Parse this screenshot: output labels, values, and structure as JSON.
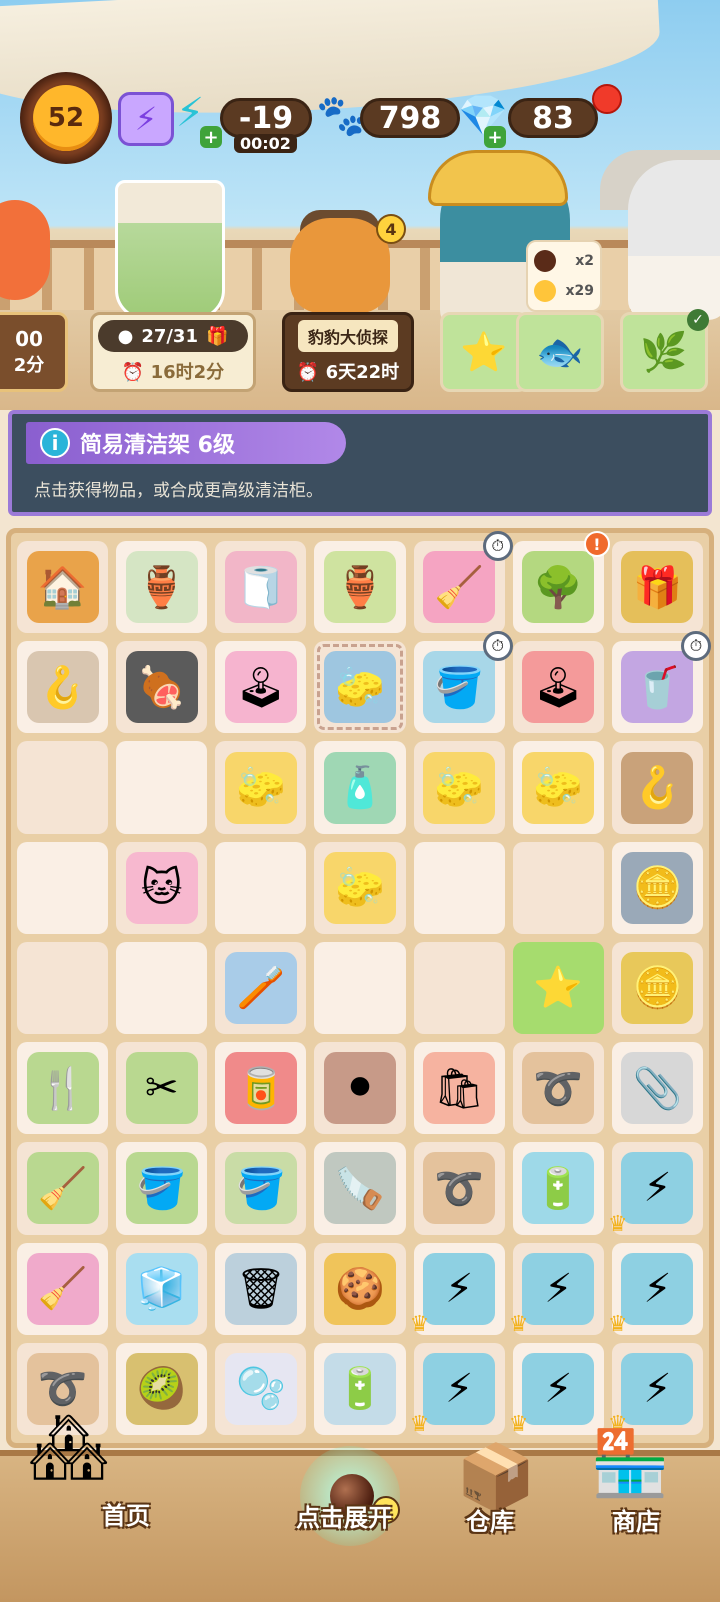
{
  "hud": {
    "level": "52",
    "energy_value": "-19",
    "energy_timer": "00:02",
    "paw_coins": "798",
    "gems": "83"
  },
  "scene": {
    "cat_badge": "4",
    "customer_needs": [
      {
        "qty": "x2"
      },
      {
        "qty": "x29"
      }
    ]
  },
  "tasks": {
    "left_partial_top": "00",
    "left_partial_bottom": "2分",
    "order_progress": "27/31",
    "order_time": "16时2分",
    "event_title": "豹豹大侦探",
    "event_time": "6天22时"
  },
  "info": {
    "title": "简易清洁架 6级",
    "description": "点击获得物品，或合成更高级清洁柜。"
  },
  "grid": {
    "rows": [
      [
        {
          "icon": "cat-house-icon",
          "glyph": "🏠",
          "bg": "#e9a34a"
        },
        {
          "icon": "orange-vase-icon",
          "glyph": "🏺",
          "bg": "#d5e5c4"
        },
        {
          "icon": "towel-rack-icon",
          "glyph": "🧻",
          "bg": "#f2b6c8"
        },
        {
          "icon": "green-vase-icon",
          "glyph": "🏺",
          "bg": "#cfe3a0"
        },
        {
          "icon": "cleaning-shelf-icon",
          "glyph": "🧹",
          "bg": "#f5a4c2",
          "badge": "timer"
        },
        {
          "icon": "bonsai-icon",
          "glyph": "🌳",
          "bg": "#b4d880",
          "badge": "alert",
          "badge_text": "!"
        },
        {
          "icon": "gift-box-icon",
          "glyph": "🎁",
          "bg": "#e5bf5a"
        }
      ],
      [
        {
          "icon": "hook-tool-icon",
          "glyph": "🪝",
          "bg": "#d9c6b0"
        },
        {
          "icon": "bbq-grill-icon",
          "glyph": "🍖",
          "bg": "#5b5b5b"
        },
        {
          "icon": "claw-machine-icon",
          "glyph": "🕹",
          "bg": "#f6b4cf"
        },
        {
          "icon": "cleaning-shelf-icon",
          "glyph": "🧽",
          "bg": "#9ec6e0",
          "focus": true
        },
        {
          "icon": "mop-bucket-icon",
          "glyph": "🪣",
          "bg": "#a8d7e8",
          "badge": "timer"
        },
        {
          "icon": "claw-machine-red-icon",
          "glyph": "🕹",
          "bg": "#f49a9a"
        },
        {
          "icon": "vending-machine-icon",
          "glyph": "🥤",
          "bg": "#c3a6e2",
          "badge": "timer"
        }
      ],
      [
        {
          "icon": "",
          "glyph": "",
          "bg": ""
        },
        {
          "icon": "",
          "glyph": "",
          "bg": ""
        },
        {
          "icon": "sponge-icon",
          "glyph": "🧽",
          "bg": "#f8d66a"
        },
        {
          "icon": "spray-bottle-icon",
          "glyph": "🧴",
          "bg": "#9fd7b4"
        },
        {
          "icon": "sponge-icon",
          "glyph": "🧽",
          "bg": "#f8d66a"
        },
        {
          "icon": "sponge-icon",
          "glyph": "🧽",
          "bg": "#f8d66a"
        },
        {
          "icon": "hook-tool-icon",
          "glyph": "🪝",
          "bg": "#c9a27a"
        }
      ],
      [
        {
          "icon": "",
          "glyph": "",
          "bg": ""
        },
        {
          "icon": "cat-towel-icon",
          "glyph": "🐱",
          "bg": "#f7b8cf"
        },
        {
          "icon": "",
          "glyph": "",
          "bg": ""
        },
        {
          "icon": "sponge-icon",
          "glyph": "🧽",
          "bg": "#f8d66a"
        },
        {
          "icon": "",
          "glyph": "",
          "bg": ""
        },
        {
          "icon": "",
          "glyph": "",
          "bg": ""
        },
        {
          "icon": "coin-tin-icon",
          "glyph": "🪙",
          "bg": "#9aa9b8"
        }
      ],
      [
        {
          "icon": "",
          "glyph": "",
          "bg": ""
        },
        {
          "icon": "",
          "glyph": "",
          "bg": ""
        },
        {
          "icon": "toothpaste-icon",
          "glyph": "🪥",
          "bg": "#a9cce8"
        },
        {
          "icon": "",
          "glyph": "",
          "bg": ""
        },
        {
          "icon": "",
          "glyph": "",
          "bg": ""
        },
        {
          "icon": "starfish-icon",
          "glyph": "⭐",
          "bg": "#a6dc6e",
          "selected": true
        },
        {
          "icon": "gold-bars-icon",
          "glyph": "🪙",
          "bg": "#e8c85a"
        }
      ],
      [
        {
          "icon": "garden-fork-icon",
          "glyph": "🍴",
          "bg": "#b9d890"
        },
        {
          "icon": "pruning-shears-icon",
          "glyph": "✂",
          "bg": "#b9d890"
        },
        {
          "icon": "soda-can-icon",
          "glyph": "🥫",
          "bg": "#f08a8a"
        },
        {
          "icon": "tapioca-balls-icon",
          "glyph": "⚫",
          "bg": "#c79a88"
        },
        {
          "icon": "plastic-bag-icon",
          "glyph": "🛍",
          "bg": "#f6b3a0"
        },
        {
          "icon": "rubber-band-icon",
          "glyph": "➰",
          "bg": "#e4c29c"
        },
        {
          "icon": "paper-clip-icon",
          "glyph": "📎",
          "bg": "#d7d7d7"
        }
      ],
      [
        {
          "icon": "rake-icon",
          "glyph": "🧹",
          "bg": "#b9d890"
        },
        {
          "icon": "paint-can-icon",
          "glyph": "🪣",
          "bg": "#b9d890"
        },
        {
          "icon": "paint-cans-icon",
          "glyph": "🪣",
          "bg": "#c9dca6"
        },
        {
          "icon": "chainsaw-icon",
          "glyph": "🪚",
          "bg": "#c0c8c0"
        },
        {
          "icon": "rubber-band-icon",
          "glyph": "➰",
          "bg": "#e4c29c"
        },
        {
          "icon": "battery-icon",
          "glyph": "🔋",
          "bg": "#9ed9e8"
        },
        {
          "icon": "battery-pack-icon",
          "glyph": "⚡",
          "bg": "#8ed0e2",
          "crown": true
        }
      ],
      [
        {
          "icon": "scraper-icon",
          "glyph": "🧹",
          "bg": "#f0aacb"
        },
        {
          "icon": "ice-cubes-icon",
          "glyph": "🧊",
          "bg": "#a9def0"
        },
        {
          "icon": "trash-can-icon",
          "glyph": "🗑",
          "bg": "#bcd0dc"
        },
        {
          "icon": "paw-cookies-icon",
          "glyph": "🍪",
          "bg": "#f0c45a"
        },
        {
          "icon": "battery-pack-icon",
          "glyph": "⚡",
          "bg": "#8ed0e2",
          "crown": true
        },
        {
          "icon": "battery-pack-icon",
          "glyph": "⚡",
          "bg": "#8ed0e2",
          "crown": true
        },
        {
          "icon": "battery-pack-icon",
          "glyph": "⚡",
          "bg": "#8ed0e2",
          "crown": true
        }
      ],
      [
        {
          "icon": "rubber-band-icon",
          "glyph": "➰",
          "bg": "#e4c29c"
        },
        {
          "icon": "fruit-bowl-icon",
          "glyph": "🥝",
          "bg": "#d8c070"
        },
        {
          "icon": "bubble-ball-icon",
          "glyph": "🫧",
          "bg": "#e6e6f2"
        },
        {
          "icon": "battery-icon",
          "glyph": "🔋",
          "bg": "#c4dce8"
        },
        {
          "icon": "battery-pack-icon",
          "glyph": "⚡",
          "bg": "#8ed0e2",
          "crown": true
        },
        {
          "icon": "battery-pack-icon",
          "glyph": "⚡",
          "bg": "#8ed0e2",
          "crown": true
        },
        {
          "icon": "battery-pack-icon",
          "glyph": "⚡",
          "bg": "#8ed0e2",
          "crown": true
        }
      ]
    ]
  },
  "nav": {
    "home": "首页",
    "expand": "点击展开",
    "expand_count": "9",
    "warehouse": "仓库",
    "shop": "商店"
  }
}
